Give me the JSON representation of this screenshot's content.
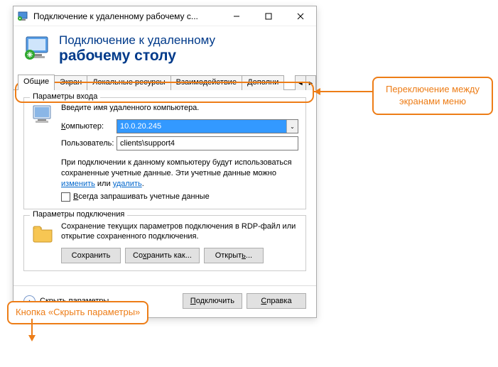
{
  "window": {
    "title": "Подключение к удаленному рабочему с..."
  },
  "header": {
    "line1": "Подключение к удаленному",
    "line2": "рабочему столу"
  },
  "tabs": {
    "items": [
      "Общие",
      "Экран",
      "Локальные ресурсы",
      "Взаимодействие",
      "Дополни"
    ]
  },
  "login": {
    "legend": "Параметры входа",
    "instruction": "Введите имя удаленного компьютера.",
    "computer_label": "Компьютер:",
    "computer_value": "10.0.20.245",
    "user_label": "Пользователь:",
    "user_value": "clients\\support4",
    "note_part1": "При подключении к данному компьютеру будут использоваться сохраненные учетные данные.  Эти учетные данные можно ",
    "note_link1": "изменить",
    "note_or": " или ",
    "note_link2": "удалить",
    "note_end": ".",
    "checkbox_label": "Всегда запрашивать учетные данные"
  },
  "conn": {
    "legend": "Параметры подключения",
    "text": "Сохранение текущих параметров подключения в RDP-файл или открытие сохраненного подключения.",
    "save": "Сохранить",
    "save_as": "Сохранить как...",
    "open": "Открыть..."
  },
  "footer": {
    "hide": "Скрыть параметры",
    "connect": "Подключить",
    "help": "Справка"
  },
  "callouts": {
    "tabs_line1": "Переключение между",
    "tabs_line2": "экранами меню",
    "hide_btn": "Кнопка «Скрыть параметры»"
  }
}
